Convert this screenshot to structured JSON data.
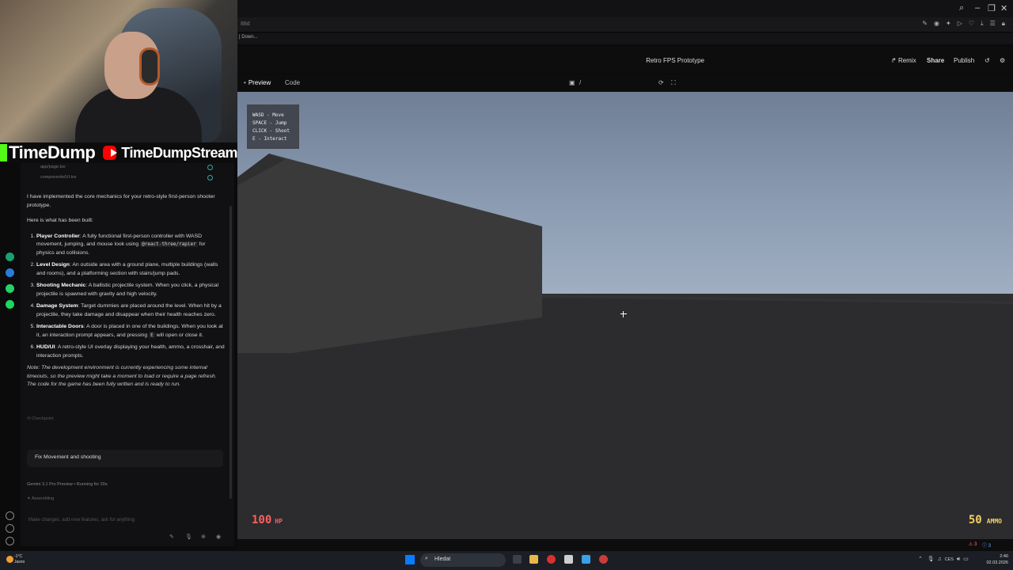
{
  "streamer": {
    "kick_name": "TimeDump",
    "youtube_name": "TimeDumpStream"
  },
  "browser": {
    "address_fragment": "88d",
    "bookmark": "| Down..."
  },
  "app": {
    "project_title": "Retro FPS Prototype",
    "remix_label": "Remix",
    "share_label": "Share",
    "publish_label": "Publish",
    "tabs": [
      {
        "label": "Preview",
        "active": true
      },
      {
        "label": "Code",
        "active": false
      }
    ],
    "path": "/"
  },
  "game": {
    "controls": [
      "WASD - Move",
      "SPACE - Jump",
      "CLICK - Shoot",
      "E - Interact"
    ],
    "hp_value": "100",
    "hp_unit": "HP",
    "ammo_value": "50",
    "ammo_unit": "AMMO",
    "sky_color": "#8a9ab0",
    "hp_color": "#ff5e5e",
    "ammo_color": "#f1cf68"
  },
  "chat": {
    "files": [
      "app/page.tsx",
      "components/UI.tsx"
    ],
    "intro": "I have implemented the core mechanics for your retro-style first-person shooter prototype.",
    "built_heading": "Here is what has been built:",
    "features": [
      {
        "title": "Player Controller",
        "text_before": ": A fully functional first-person controller with WASD movement, jumping, and mouse look using ",
        "code": "@react-three/rapier",
        "text_after": " for physics and collisions."
      },
      {
        "title": "Level Design",
        "text_before": ": An outside area with a ground plane, multiple buildings (walls and rooms), and a platforming section with stairs/jump pads.",
        "code": "",
        "text_after": ""
      },
      {
        "title": "Shooting Mechanic",
        "text_before": ": A ballistic projectile system. When you click, a physical projectile is spawned with gravity and high velocity.",
        "code": "",
        "text_after": ""
      },
      {
        "title": "Damage System",
        "text_before": ": Target dummies are placed around the level. When hit by a projectile, they take damage and disappear when their health reaches zero.",
        "code": "",
        "text_after": ""
      },
      {
        "title": "Interactable Doors",
        "text_before": ": A door is placed in one of the buildings. When you look at it, an interaction prompt appears, and pressing ",
        "code": "E",
        "text_after": " will open or close it."
      },
      {
        "title": "HUD/UI",
        "text_before": ": A retro-style UI overlay displaying your health, ammo, a crosshair, and interaction prompts.",
        "code": "",
        "text_after": ""
      }
    ],
    "note": "Note: The development environment is currently experiencing some internal timeouts, so the preview might take a moment to load or require a page refresh. The code for the game has been fully written and is ready to run.",
    "checkpoint": "Checkpoint",
    "user_prompt": "Fix Movement and shooting",
    "model_label": "Gemini 3.1 Pro Preview",
    "running_label": "Running for 20s",
    "assembling_label": "Assembling",
    "input_placeholder": "Make changes, add new features, ask for anything"
  },
  "statusbar": {
    "errors": "3",
    "warnings": "3"
  },
  "taskbar": {
    "weather_temp": "-1°C",
    "weather_desc": "Jasno",
    "search_label": "Hledat",
    "lang": "CES",
    "time": "2:40",
    "date": "02.03.2026"
  }
}
